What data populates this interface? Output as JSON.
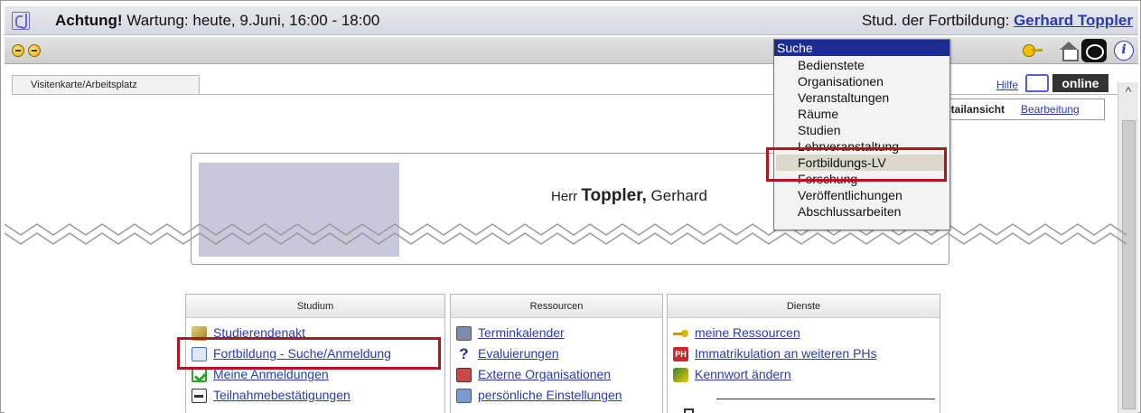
{
  "window": {
    "notice_bold": "Achtung!",
    "notice_text": " Wartung: heute, 9.Juni, 16:00 - 18:00",
    "role_text": "Stud. der Fortbildung: ",
    "user_name": "Gerhard Toppler"
  },
  "tabs": [
    {
      "label": "Visitenkarte/Arbeitsplatz"
    }
  ],
  "top_links": {
    "help": "Hilfe",
    "brand": "online",
    "detail_view": "etailansicht",
    "edit": "Bearbeitung"
  },
  "person": {
    "salutation": "Herr ",
    "last_name": "Toppler,",
    "first_name": " Gerhard"
  },
  "search_dropdown": {
    "header": "Suche",
    "items": [
      "Bedienstete",
      "Organisationen",
      "Veranstaltungen",
      "Räume",
      "Studien",
      "Lehrveranstaltung",
      "Fortbildungs-LV",
      "Forschung",
      "Veröffentlichungen",
      "Abschlussarbeiten"
    ],
    "highlighted": "Fortbildungs-LV"
  },
  "panels": {
    "studium": {
      "title": "Studium",
      "links": [
        "Studierendenakt",
        "Fortbildung - Suche/Anmeldung",
        "Meine Anmeldungen",
        "Teilnahmebestätigungen"
      ]
    },
    "ressourcen": {
      "title": "Ressourcen",
      "links": [
        "Terminkalender",
        "Evaluierungen",
        "Externe Organisationen",
        "persönliche Einstellungen"
      ]
    },
    "dienste": {
      "title": "Dienste",
      "links": [
        "meine Ressourcen",
        "Immatrikulation an weiteren PHs",
        "Kennwort ändern"
      ]
    }
  },
  "colors": {
    "link": "#2a3bb0",
    "highlight_box": "#b5141c",
    "dropdown_header": "#1c2d8f"
  }
}
